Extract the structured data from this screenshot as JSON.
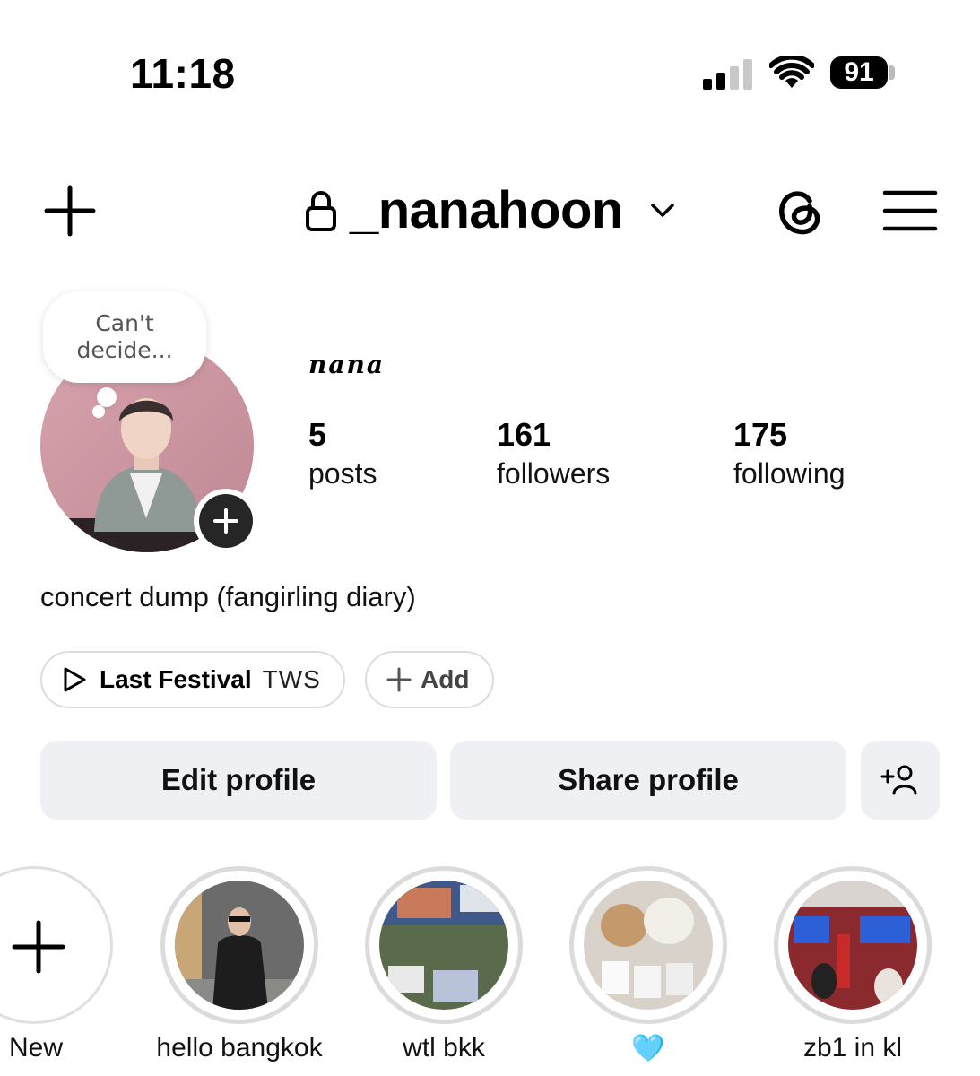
{
  "status_bar": {
    "time": "11:18",
    "battery": "91",
    "icons": [
      "cellular-signal-icon",
      "wifi-icon",
      "battery-icon"
    ]
  },
  "header": {
    "username": "_nanahoon",
    "icons": [
      "plus-icon",
      "lock-icon",
      "chevron-down-icon",
      "threads-icon",
      "hamburger-menu-icon"
    ]
  },
  "profile": {
    "note": "Can't\ndecide...",
    "display_name": "nana",
    "stats": [
      {
        "value": "5",
        "label": "posts"
      },
      {
        "value": "161",
        "label": "followers"
      },
      {
        "value": "175",
        "label": "following"
      }
    ],
    "bio": "concert dump (fangirling diary)"
  },
  "music": {
    "song": "Last Festival",
    "artist": "TWS",
    "add_label": "Add"
  },
  "buttons": {
    "edit": "Edit profile",
    "share": "Share profile"
  },
  "highlights": [
    {
      "label": "New"
    },
    {
      "label": "hello bangkok"
    },
    {
      "label": "wtl bkk"
    },
    {
      "label": "🩵"
    },
    {
      "label": "zb1 in kl"
    }
  ],
  "colors": {
    "button_bg": "#eff0f4",
    "ring": "#dbdbdb",
    "text": "#000000"
  }
}
